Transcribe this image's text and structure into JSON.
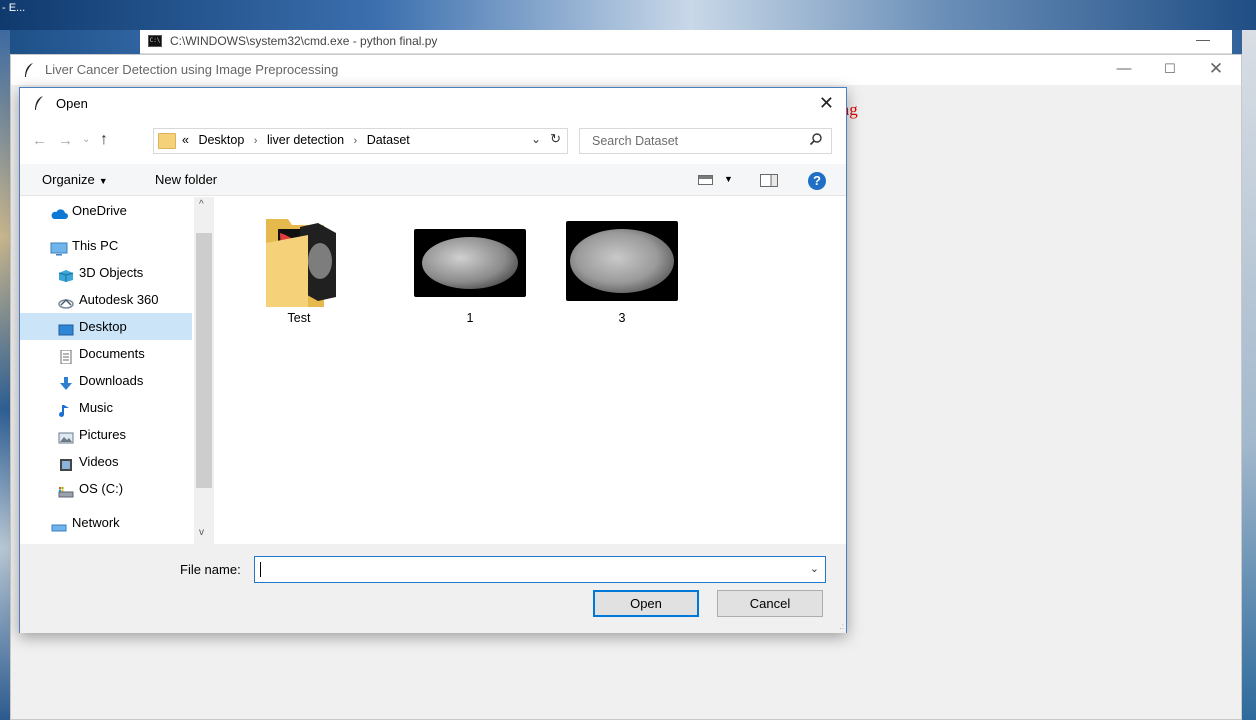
{
  "desktop": {
    "taskbar_fragment": "- E..."
  },
  "cmd_window": {
    "icon_text": "C:\\",
    "title": "C:\\WINDOWS\\system32\\cmd.exe - python  final.py",
    "minimize_glyph": "—"
  },
  "app_window": {
    "title": "Liver Cancer Detection using Image Preprocessing",
    "heading_fragment": "ing",
    "controls": {
      "minimize": "—",
      "maximize": "☐",
      "close": "✕"
    },
    "heading_color": "#e00000"
  },
  "dialog": {
    "title": "Open",
    "close_glyph": "✕",
    "nav": {
      "back": "←",
      "forward": "→",
      "recent": "⌄",
      "up": "↑"
    },
    "address": {
      "overflow": "«",
      "segments": [
        "Desktop",
        "liver detection",
        "Dataset"
      ],
      "separator": "›",
      "dropdown": "⌄",
      "refresh": "↻"
    },
    "search": {
      "placeholder": "Search Dataset",
      "icon": "⚲"
    },
    "toolbar": {
      "organize_label": "Organize",
      "organize_caret": "▼",
      "new_folder_label": "New folder",
      "view_caret": "▼",
      "help_glyph": "?"
    },
    "nav_pane": {
      "items": [
        {
          "label": "OneDrive",
          "icon": "onedrive-icon"
        },
        {
          "label": "This PC",
          "icon": "computer-icon"
        },
        {
          "label": "3D Objects",
          "icon": "3d-objects-icon"
        },
        {
          "label": "Autodesk 360",
          "icon": "autodesk-icon"
        },
        {
          "label": "Desktop",
          "icon": "desktop-icon",
          "selected": true
        },
        {
          "label": "Documents",
          "icon": "documents-icon"
        },
        {
          "label": "Downloads",
          "icon": "downloads-icon"
        },
        {
          "label": "Music",
          "icon": "music-icon"
        },
        {
          "label": "Pictures",
          "icon": "pictures-icon"
        },
        {
          "label": "Videos",
          "icon": "videos-icon"
        },
        {
          "label": "OS (C:)",
          "icon": "drive-icon"
        },
        {
          "label": "Network",
          "icon": "network-icon"
        }
      ],
      "scroll_up": "^",
      "scroll_down": "v"
    },
    "files": [
      {
        "name": "Test",
        "type": "folder"
      },
      {
        "name": "1",
        "type": "image"
      },
      {
        "name": "3",
        "type": "image"
      }
    ],
    "filename": {
      "label": "File name:",
      "value": "",
      "dropdown": "⌄"
    },
    "buttons": {
      "open": "Open",
      "cancel": "Cancel"
    },
    "resize_grip": ".:",
    "accent_color": "#0078d7",
    "selection_color": "#cce4f7"
  }
}
